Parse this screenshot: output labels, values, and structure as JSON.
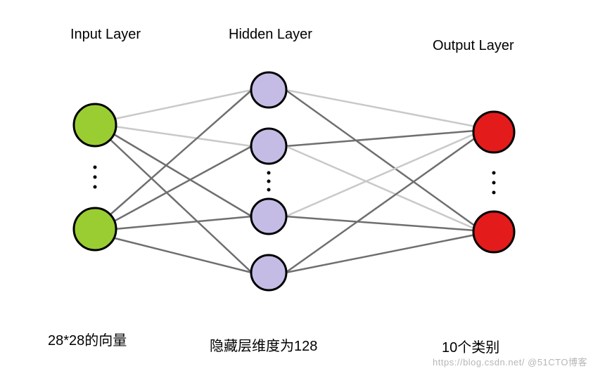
{
  "layers": {
    "input": {
      "title": "Input Layer",
      "caption": "28*28的向量"
    },
    "hidden": {
      "title": "Hidden Layer",
      "caption": "隐藏层维度为128"
    },
    "output": {
      "title": "Output Layer",
      "caption": "10个类别"
    }
  },
  "colors": {
    "input_node": "#9ACD32",
    "hidden_node": "#C5BCE6",
    "output_node": "#E31B1B",
    "stroke": "#000000",
    "edge_dark": "#6F6F6F",
    "edge_light": "#C9C9C9"
  },
  "watermark": "https://blog.csdn.net/  @51CTO博客",
  "chart_data": {
    "type": "diagram",
    "title": "",
    "network": {
      "layers": [
        {
          "name": "Input Layer",
          "size_text": "28*28的向量",
          "size": 784,
          "drawn_nodes": 2
        },
        {
          "name": "Hidden Layer",
          "size_text": "隐藏层维度为128",
          "size": 128,
          "drawn_nodes": 4
        },
        {
          "name": "Output Layer",
          "size_text": "10个类别",
          "size": 10,
          "drawn_nodes": 2
        }
      ],
      "connectivity": "fully-connected"
    }
  }
}
